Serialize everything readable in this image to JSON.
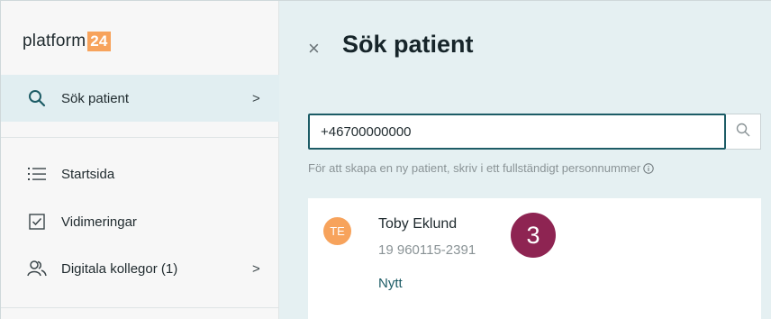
{
  "colors": {
    "accent": "#1d5c66",
    "logo_badge": "#f7a35c",
    "avatar": "#f7a35c",
    "step_badge": "#8e2452",
    "sidebar_active": "#e1eef1",
    "main_bg": "#e5f0f2"
  },
  "logo": {
    "text": "platform",
    "badge": "24"
  },
  "sidebar": {
    "active": {
      "icon": "search-icon",
      "label": "Sök patient",
      "chevron": ">"
    },
    "items": [
      {
        "icon": "list-icon",
        "label": "Startsida"
      },
      {
        "icon": "checkbox-icon",
        "label": "Vidimeringar"
      },
      {
        "icon": "users-icon",
        "label": "Digitala kollegor (1)",
        "chevron": ">"
      }
    ]
  },
  "header": {
    "close": "×",
    "title": "Sök patient"
  },
  "search": {
    "value": "+46700000000",
    "button_icon": "search-icon"
  },
  "hint": {
    "text": "För att skapa en ny patient, skriv i ett fullständigt personnummer",
    "icon": "info-icon"
  },
  "patient": {
    "initials": "TE",
    "name": "Toby Eklund",
    "pnr": "19 960115-2391",
    "status": "Nytt"
  },
  "step": {
    "number": "3"
  }
}
